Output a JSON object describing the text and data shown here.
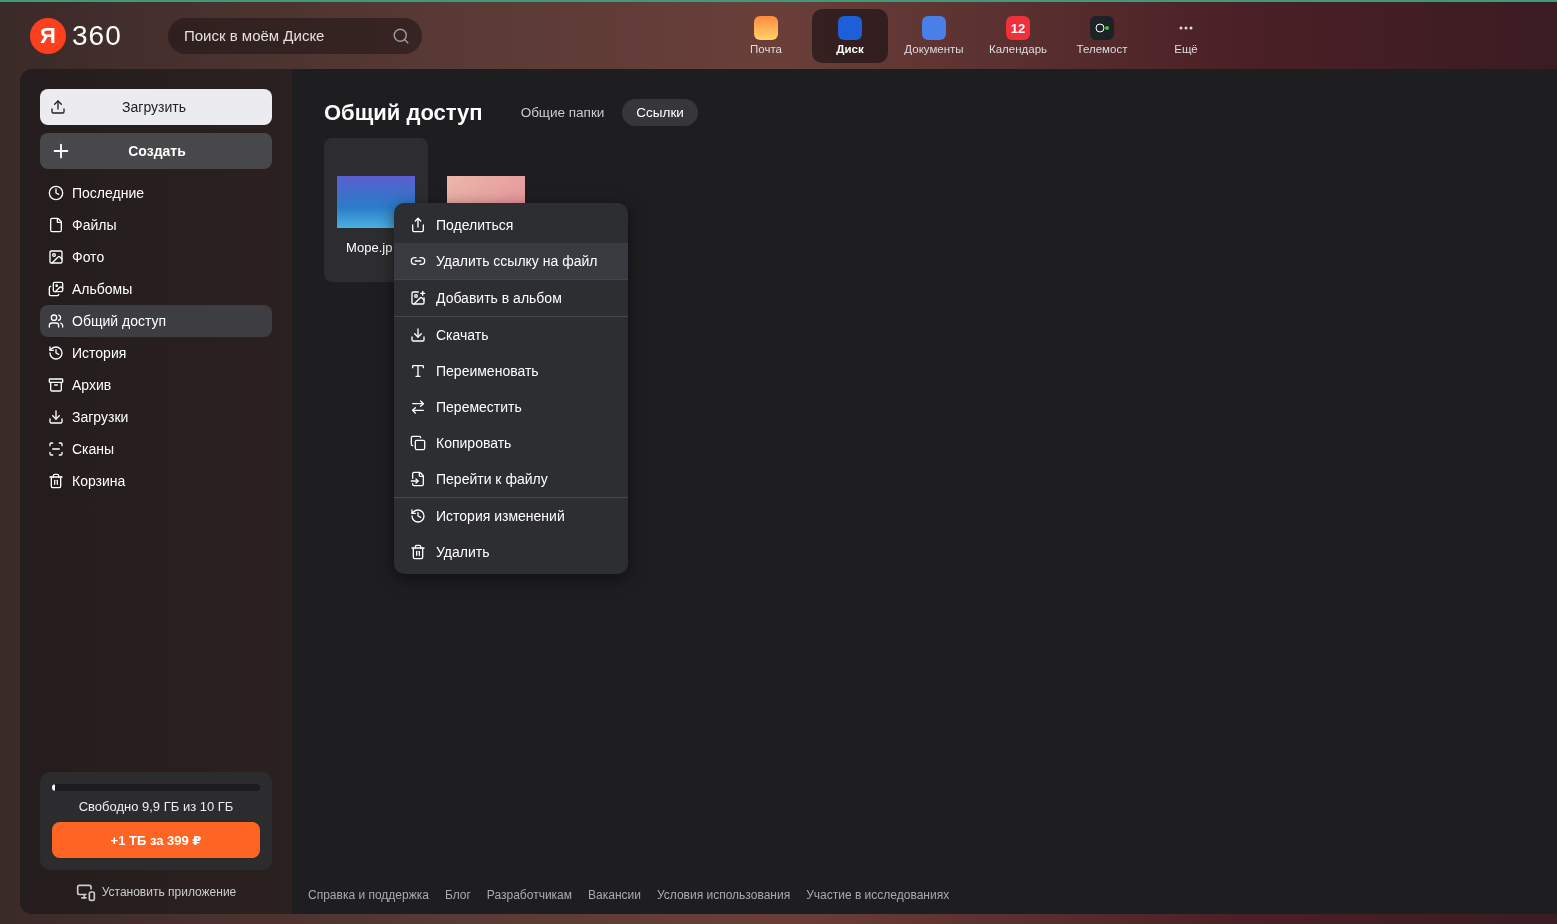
{
  "logo": {
    "mark": "Я",
    "text": "360"
  },
  "search": {
    "placeholder": "Поиск в моём Диске"
  },
  "apps": [
    {
      "label": "Почта",
      "selected": false,
      "kind": "mail"
    },
    {
      "label": "Диск",
      "selected": true,
      "kind": "disk"
    },
    {
      "label": "Документы",
      "selected": false,
      "kind": "docs"
    },
    {
      "label": "Календарь",
      "selected": false,
      "kind": "calendar",
      "badge": "12"
    },
    {
      "label": "Телемост",
      "selected": false,
      "kind": "telemost"
    },
    {
      "label": "Ещё",
      "selected": false,
      "kind": "more"
    }
  ],
  "sidebar": {
    "upload": "Загрузить",
    "create": "Создать",
    "items": [
      {
        "label": "Последние",
        "selected": false
      },
      {
        "label": "Файлы",
        "selected": false
      },
      {
        "label": "Фото",
        "selected": false
      },
      {
        "label": "Альбомы",
        "selected": false
      },
      {
        "label": "Общий доступ",
        "selected": true
      },
      {
        "label": "История",
        "selected": false
      },
      {
        "label": "Архив",
        "selected": false
      },
      {
        "label": "Загрузки",
        "selected": false
      },
      {
        "label": "Сканы",
        "selected": false
      },
      {
        "label": "Корзина",
        "selected": false
      }
    ],
    "storage": {
      "level": 0.01,
      "text": "Свободно 9,9 ГБ из 10 ГБ",
      "buy": "+1 ТБ за 399 ₽"
    },
    "install": "Установить приложение"
  },
  "page": {
    "title": "Общий доступ",
    "tabs": [
      {
        "label": "Общие папки",
        "selected": false
      },
      {
        "label": "Ссылки",
        "selected": true
      }
    ]
  },
  "files": [
    {
      "name": "Море.jp",
      "selected": true,
      "kind": "sea"
    },
    {
      "selected": false,
      "kind": "food"
    }
  ],
  "menu": {
    "groups": [
      [
        {
          "label": "Поделиться",
          "selected": false
        },
        {
          "label": "Удалить ссылку на файл",
          "selected": true
        }
      ],
      [
        {
          "label": "Добавить в альбом",
          "selected": false
        }
      ],
      [
        {
          "label": "Скачать",
          "selected": false
        },
        {
          "label": "Переименовать",
          "selected": false
        },
        {
          "label": "Переместить",
          "selected": false
        },
        {
          "label": "Копировать",
          "selected": false
        },
        {
          "label": "Перейти к файлу",
          "selected": false
        }
      ],
      [
        {
          "label": "История изменений",
          "selected": false
        },
        {
          "label": "Удалить",
          "selected": false
        }
      ]
    ]
  },
  "footer": [
    "Справка и поддержка",
    "Блог",
    "Разработчикам",
    "Вакансии",
    "Условия использования",
    "Участие в исследованиях"
  ]
}
